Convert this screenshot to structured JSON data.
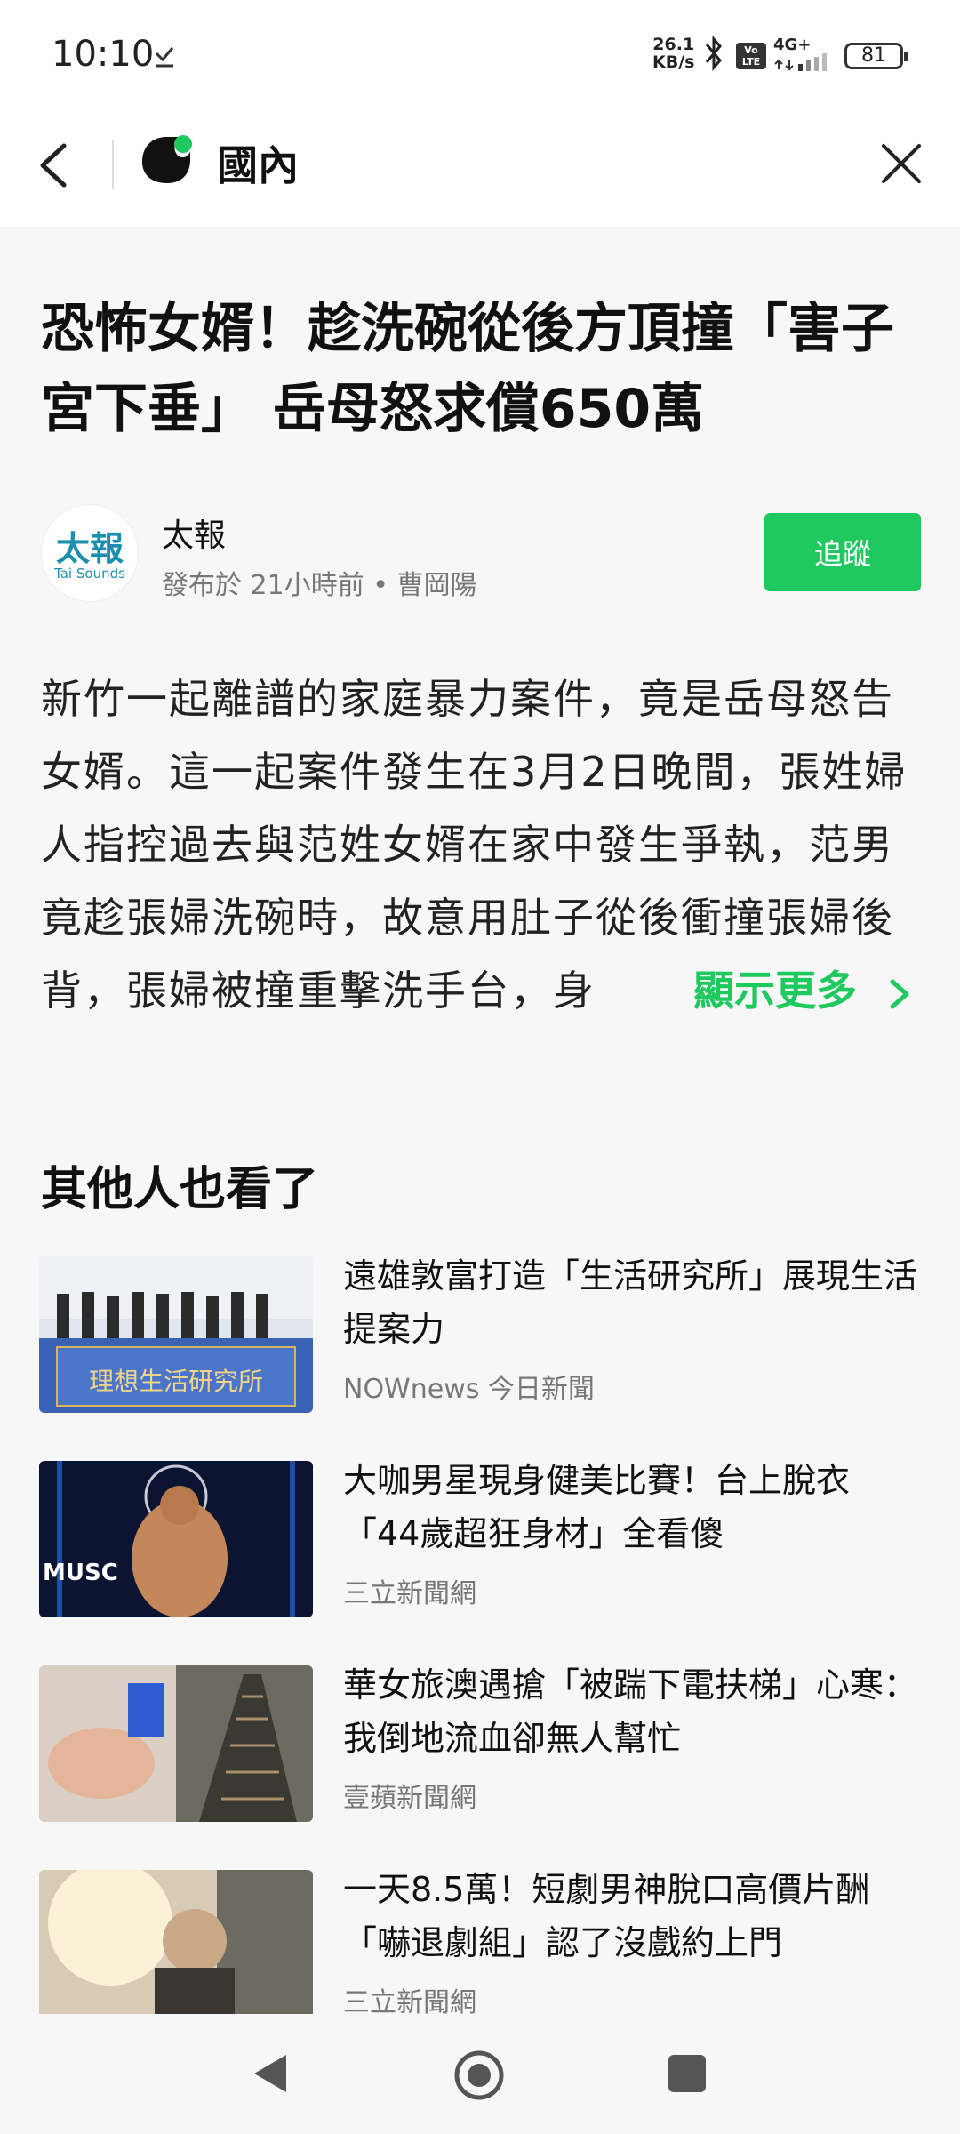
{
  "status_bar": {
    "time": "10:10",
    "net_speed_value": "26.1",
    "net_speed_unit": "KB/s",
    "volte": "Vo LTE",
    "network": "4G+",
    "battery": "81",
    "icons": [
      "download-done-icon",
      "bluetooth-icon",
      "signal-icon",
      "battery-icon"
    ]
  },
  "header": {
    "title": "國內",
    "icons": [
      "back-icon",
      "app-logo",
      "close-icon"
    ]
  },
  "article": {
    "title": "恐怖女婿！趁洗碗從後方頂撞「害子宮下垂」 岳母怒求償650萬",
    "source": {
      "avatar_text": "太報",
      "avatar_sub": "Tai Sounds",
      "name": "太報",
      "meta": "發布於 21小時前  •  曹岡陽"
    },
    "follow_label": "追蹤",
    "body": "新竹一起離譜的家庭暴力案件，竟是岳母怒告女婿。這一起案件發生在3月2日晚間，張姓婦人指控過去與范姓女婿在家中發生爭執，范男竟趁張婦洗碗時，故意用肚子從後衝撞張婦後背，張婦被撞重擊洗手台，身",
    "show_more": "顯示更多"
  },
  "related": {
    "heading": "其他人也看了",
    "items": [
      {
        "title": "遠雄敦富打造「生活研究所」展現生活提案力",
        "source": "NOWnews 今日新聞",
        "thumb_text": "理想生活研究所"
      },
      {
        "title": "大咖男星現身健美比賽！台上脫衣「44歲超狂身材」全看傻",
        "source": "三立新聞網",
        "thumb_text": "MUSC"
      },
      {
        "title": "華女旅澳遇搶「被踹下電扶梯」心寒：我倒地流血卻無人幫忙",
        "source": "壹蘋新聞網",
        "thumb_text": ""
      },
      {
        "title": "一天8.5萬！短劇男神脫口高價片酬「嚇退劇組」認了沒戲約上門",
        "source": "三立新聞網",
        "thumb_text": ""
      }
    ]
  },
  "nav_bar": {
    "icons": [
      "nav-back-icon",
      "nav-home-icon",
      "nav-recents-icon"
    ]
  },
  "colors": {
    "accent": "#1ec95e",
    "background": "#f7f7f7",
    "text": "#111111",
    "secondary_text": "#777777",
    "avatar_brand": "#1a8fae"
  }
}
